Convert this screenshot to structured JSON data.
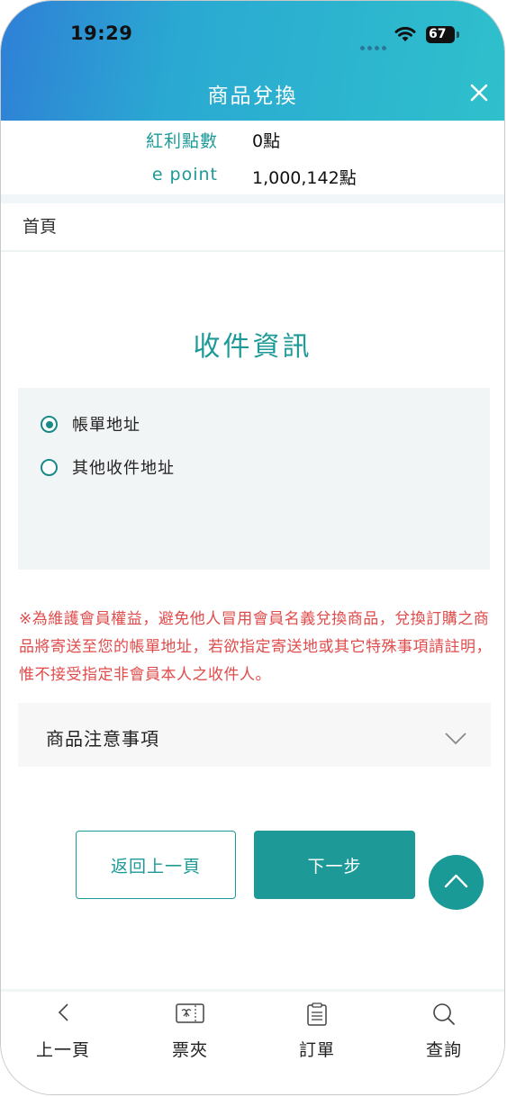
{
  "status_bar": {
    "time": "19:29",
    "battery": "67"
  },
  "header": {
    "title": "商品兌換"
  },
  "points": {
    "bonus_label": "紅利點數",
    "bonus_value": "0點",
    "epoint_label": "e point",
    "epoint_value": "1,000,142點"
  },
  "breadcrumb": {
    "home": "首頁"
  },
  "recipient": {
    "title": "收件資訊",
    "options": [
      {
        "label": "帳單地址",
        "selected": true
      },
      {
        "label": "其他收件地址",
        "selected": false
      }
    ]
  },
  "notice": "※為維護會員權益，避免他人冒用會員名義兌換商品，兌換訂購之商品將寄送至您的帳單地址，若欲指定寄送地或其它特殊事項請註明，惟不接受指定非會員本人之收件人。",
  "accordion": {
    "label": "商品注意事項"
  },
  "buttons": {
    "back": "返回上一頁",
    "next": "下一步"
  },
  "tabbar": {
    "items": [
      {
        "label": "上一頁",
        "icon": "chevron-left-icon"
      },
      {
        "label": "票夾",
        "icon": "ticket-icon"
      },
      {
        "label": "訂單",
        "icon": "clipboard-icon"
      },
      {
        "label": "查詢",
        "icon": "search-icon"
      }
    ]
  },
  "colors": {
    "accent": "#1d9a97",
    "notice": "#e04b4b"
  }
}
